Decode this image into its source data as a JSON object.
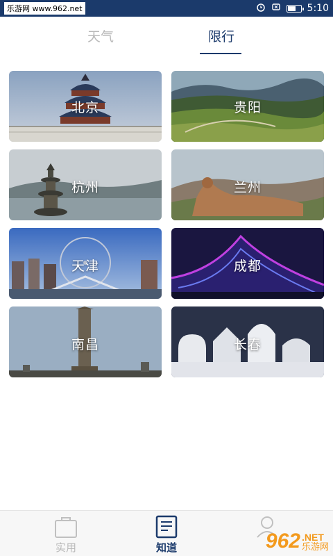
{
  "status_bar": {
    "site_label": "乐游网 www.962.net",
    "time": "5:10",
    "alarm_icon": "alarm-icon",
    "mute_icon": "mute-icon",
    "battery_icon": "battery-icon",
    "battery_level": 0.6
  },
  "tabs": [
    {
      "label": "天气",
      "active": false
    },
    {
      "label": "限行",
      "active": true
    }
  ],
  "cities": [
    {
      "name": "北京",
      "theme": "#5f6f86"
    },
    {
      "name": "贵阳",
      "theme": "#4a6b3a"
    },
    {
      "name": "杭州",
      "theme": "#7b8a93"
    },
    {
      "name": "兰州",
      "theme": "#8a6a4a"
    },
    {
      "name": "天津",
      "theme": "#4a6fb5"
    },
    {
      "name": "成都",
      "theme": "#2a1f6a"
    },
    {
      "name": "南昌",
      "theme": "#8a8a80"
    },
    {
      "name": "长春",
      "theme": "#3a4a6a"
    }
  ],
  "bottom_nav": [
    {
      "label": "实用",
      "icon": "briefcase-icon",
      "active": false
    },
    {
      "label": "知道",
      "icon": "document-icon",
      "active": true
    },
    {
      "label": "",
      "icon": "user-icon",
      "active": false
    }
  ],
  "watermark": {
    "number": "962",
    "domain": ".NET",
    "text": "乐游网"
  },
  "colors": {
    "primary": "#1b3a6b",
    "inactive": "#b8b8b8"
  }
}
